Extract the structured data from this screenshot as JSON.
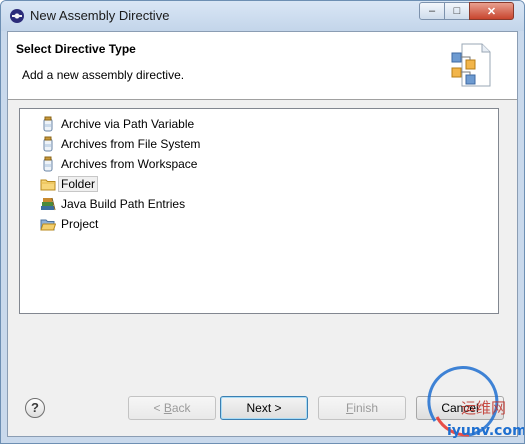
{
  "window": {
    "title": "New Assembly Directive",
    "controls": {
      "minimize": "–",
      "maximize": "□",
      "close": "✕"
    }
  },
  "header": {
    "title": "Select Directive Type",
    "description": "Add a new assembly directive."
  },
  "list": {
    "items": [
      {
        "label": "Archive via Path Variable",
        "icon": "jar-icon",
        "selected": false
      },
      {
        "label": "Archives from File System",
        "icon": "jar-icon",
        "selected": false
      },
      {
        "label": "Archives from Workspace",
        "icon": "jar-icon",
        "selected": false
      },
      {
        "label": "Folder",
        "icon": "folder-icon",
        "selected": true
      },
      {
        "label": "Java Build Path Entries",
        "icon": "library-icon",
        "selected": false
      },
      {
        "label": "Project",
        "icon": "project-folder-icon",
        "selected": false
      }
    ]
  },
  "footer": {
    "help": "?",
    "buttons": {
      "back": {
        "prefix": "< ",
        "mnemonic": "B",
        "rest": "ack"
      },
      "next": "Next >",
      "finish": {
        "mnemonic": "F",
        "rest": "inish"
      },
      "cancel": "Cancel"
    }
  },
  "watermark": {
    "line1": "运维网",
    "line2": "iyunv.com"
  }
}
